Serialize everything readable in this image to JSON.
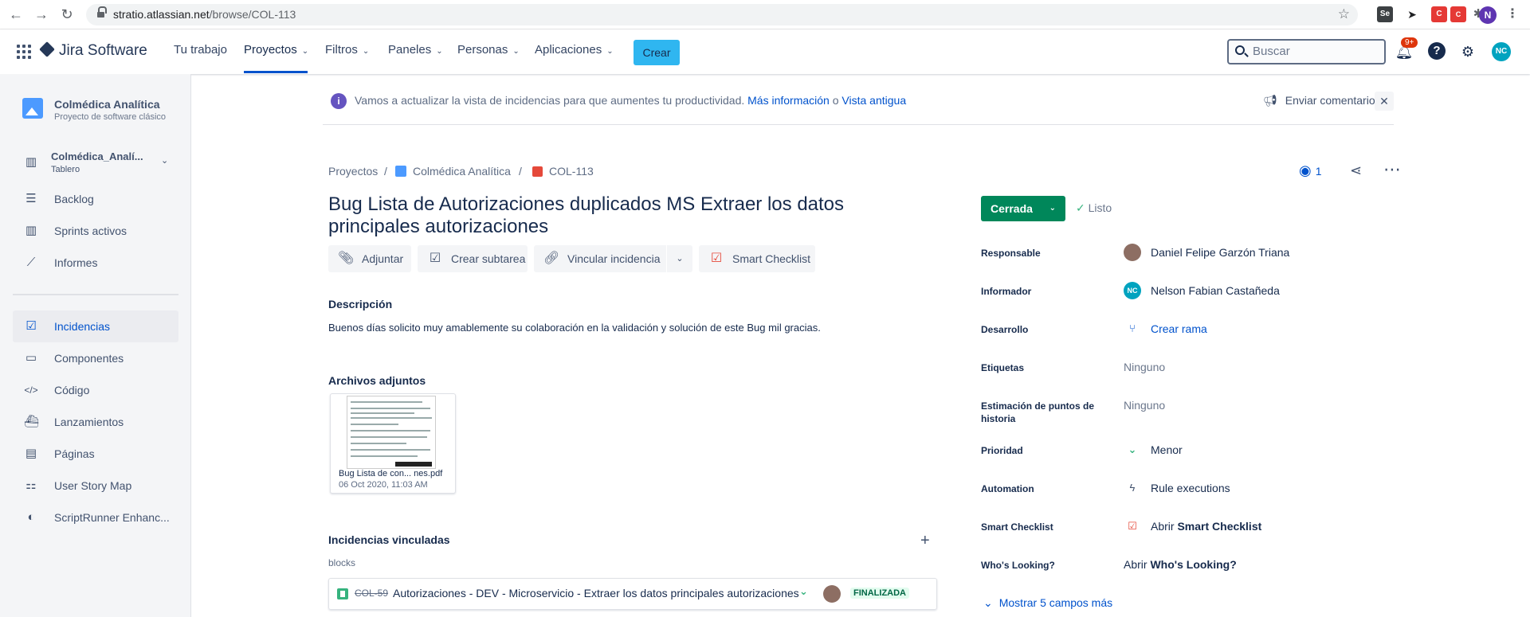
{
  "browser": {
    "url_host": "stratio.atlassian.net",
    "url_path": "/browse/COL-113",
    "profile_initial": "N"
  },
  "topnav": {
    "brand": "Jira Software",
    "items": [
      {
        "label": "Tu trabajo"
      },
      {
        "label": "Proyectos"
      },
      {
        "label": "Filtros"
      },
      {
        "label": "Paneles"
      },
      {
        "label": "Personas"
      },
      {
        "label": "Aplicaciones"
      }
    ],
    "create_label": "Crear",
    "search_placeholder": "Buscar",
    "notification_badge": "9+",
    "user_initials": "NC"
  },
  "sidebar": {
    "project_name": "Colmédica Analítica",
    "project_type": "Proyecto de software clásico",
    "board_name": "Colmédica_Analí...",
    "board_type": "Tablero",
    "planning": [
      {
        "label": "Backlog",
        "icon": "backlog-icon"
      },
      {
        "label": "Sprints activos",
        "icon": "sprints-icon"
      },
      {
        "label": "Informes",
        "icon": "reports-icon"
      }
    ],
    "development": [
      {
        "label": "Incidencias",
        "icon": "issues-icon"
      },
      {
        "label": "Componentes",
        "icon": "components-icon"
      },
      {
        "label": "Código",
        "icon": "code-icon"
      },
      {
        "label": "Lanzamientos",
        "icon": "releases-icon"
      },
      {
        "label": "Páginas",
        "icon": "pages-icon"
      },
      {
        "label": "User Story Map",
        "icon": "story-map-icon"
      },
      {
        "label": "ScriptRunner Enhanc...",
        "icon": "scriptrunner-icon"
      }
    ]
  },
  "banner": {
    "text": "Vamos a actualizar la vista de incidencias para que aumentes tu productividad.",
    "link1": "Más información",
    "or": "o",
    "link2": "Vista antigua",
    "feedback": "Enviar comentarios"
  },
  "breadcrumb": {
    "root": "Proyectos",
    "project": "Colmédica Analítica",
    "issue_key": "COL-113"
  },
  "issue": {
    "title": "Bug Lista de Autorizaciones duplicados MS Extraer los datos principales autorizaciones",
    "watchers": "1",
    "buttons": {
      "attach": "Adjuntar",
      "subtask": "Crear subtarea",
      "link": "Vincular incidencia",
      "checklist": "Smart Checklist"
    },
    "description_heading": "Descripción",
    "description": "Buenos días solicito muy amablemente su colaboración en la validación y  solución de este Bug mil gracias.",
    "attachments_heading": "Archivos adjuntos",
    "attachment_name": "Bug Lista de con... nes.pdf",
    "attachment_date": "06 Oct 2020, 11:03 AM",
    "linked_heading": "Incidencias vinculadas",
    "link_type": "blocks",
    "linked": {
      "key": "COL-59",
      "summary": "Autorizaciones - DEV - Microservicio - Extraer los datos principales autorizaciones",
      "status": "FINALIZADA"
    }
  },
  "details": {
    "status": "Cerrada",
    "resolution": "Listo",
    "fields": [
      {
        "label": "Responsable",
        "value": "Daniel Felipe Garzón Triana"
      },
      {
        "label": "Informador",
        "value": "Nelson Fabian Castañeda"
      },
      {
        "label": "Desarrollo",
        "value": "Crear rama"
      },
      {
        "label": "Etiquetas",
        "value": "Ninguno"
      },
      {
        "label": "Estimación de puntos de historia",
        "value": "Ninguno"
      },
      {
        "label": "Prioridad",
        "value": "Menor"
      },
      {
        "label": "Automation",
        "value": "Rule executions"
      },
      {
        "label": "Smart Checklist",
        "value_prefix": "Abrir",
        "value_bold": "Smart Checklist"
      },
      {
        "label": "Who's Looking?",
        "value_prefix": "Abrir",
        "value_bold": "Who's Looking?"
      }
    ],
    "reporter_initials": "NC",
    "show_more": "Mostrar 5 campos más"
  },
  "colors": {
    "accent": "#0052cc",
    "status_done": "#00875a",
    "create_button": "#2fb6f0"
  }
}
